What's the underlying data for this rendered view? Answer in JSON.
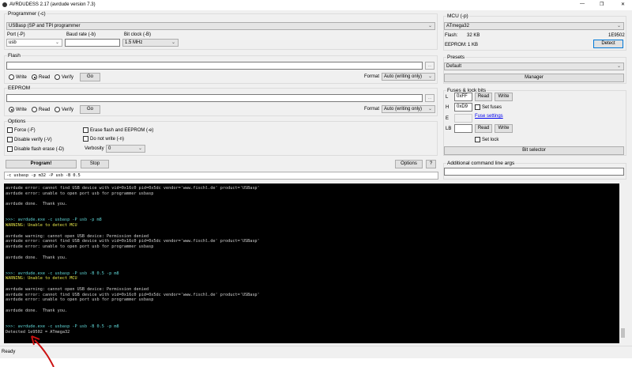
{
  "window": {
    "title": "AVRDUDESS 2.17 (avrdude version 7.3)",
    "minimize": "—",
    "restore": "❐",
    "close": "✕"
  },
  "programmer": {
    "label": "Programmer (-c)",
    "value": "USBasp (SP and TPI programmer",
    "port_label": "Port (-P)",
    "port_value": "usb",
    "baud_label": "Baud rate (-b)",
    "baud_value": "",
    "bitclock_label": "Bit clock (-B)",
    "bitclock_value": "1.5 MHz"
  },
  "flash": {
    "label": "Flash",
    "path": "",
    "browse": "...",
    "write": "Write",
    "read": "Read",
    "verify": "Verify",
    "go": "Go",
    "format_label": "Format",
    "format_value": "Auto (writing only)"
  },
  "eeprom": {
    "label": "EEPROM",
    "path": "",
    "browse": "...",
    "write": "Write",
    "read": "Read",
    "verify": "Verify",
    "go": "Go",
    "format_label": "Format",
    "format_value": "Auto (writing only)"
  },
  "options": {
    "label": "Options",
    "force": "Force (-F)",
    "disable_verify": "Disable verify (-V)",
    "disable_flash_erase": "Disable flash erase (-D)",
    "erase": "Erase flash and EEPROM (-e)",
    "no_write": "Do not write (-n)",
    "verbosity_label": "Verbosity",
    "verbosity_value": "0"
  },
  "actions": {
    "program": "Program!",
    "stop": "Stop",
    "options": "Options",
    "help": "?",
    "command": "-c usbasp -p m32 -P usb -B 0.5"
  },
  "mcu": {
    "label": "MCU (-p)",
    "value": "ATmega32",
    "flash_label": "Flash:",
    "flash_value": "32 KB",
    "signature": "1E9502",
    "eeprom_label": "EEPROM:",
    "eeprom_value": "1 KB",
    "detect": "Detect"
  },
  "presets": {
    "label": "Presets",
    "value": "Default",
    "manager": "Manager"
  },
  "fuses": {
    "label": "Fuses & lock bits",
    "L": "L",
    "L_value": "0xFF",
    "H": "H",
    "H_value": "0xD9",
    "E": "E",
    "E_value": "",
    "LB": "LB",
    "LB_value": "",
    "read": "Read",
    "write": "Write",
    "set_fuses": "Set fuses",
    "fuse_settings": "Fuse settings",
    "set_lock": "Set lock",
    "bit_selector": "Bit selector"
  },
  "additional": {
    "label": "Additional command line args",
    "value": ""
  },
  "console": [
    {
      "t": "n",
      "text": "avrdude error: cannot find USB device with vid=0x16c0 pid=0x5dc vendor='www.fischl.de' product='USBasp'"
    },
    {
      "t": "n",
      "text": "avrdude error: unable to open port usb for programmer usbasp"
    },
    {
      "t": "n",
      "text": ""
    },
    {
      "t": "n",
      "text": "avrdude done.  Thank you."
    },
    {
      "t": "n",
      "text": ""
    },
    {
      "t": "n",
      "text": ""
    },
    {
      "t": "cmd",
      "text": ">>>: avrdude.exe -c usbasp -P usb -p m8"
    },
    {
      "t": "warn",
      "text": "WARNING: Unable to detect MCU"
    },
    {
      "t": "n",
      "text": ""
    },
    {
      "t": "n",
      "text": "avrdude warning: cannot open USB device: Permission denied"
    },
    {
      "t": "n",
      "text": "avrdude error: cannot find USB device with vid=0x16c0 pid=0x5dc vendor='www.fischl.de' product='USBasp'"
    },
    {
      "t": "n",
      "text": "avrdude error: unable to open port usb for programmer usbasp"
    },
    {
      "t": "n",
      "text": ""
    },
    {
      "t": "n",
      "text": "avrdude done.  Thank you."
    },
    {
      "t": "n",
      "text": ""
    },
    {
      "t": "n",
      "text": ""
    },
    {
      "t": "cmd",
      "text": ">>>: avrdude.exe -c usbasp -P usb -B 0.5 -p m8"
    },
    {
      "t": "warn",
      "text": "WARNING: Unable to detect MCU"
    },
    {
      "t": "n",
      "text": ""
    },
    {
      "t": "n",
      "text": "avrdude warning: cannot open USB device: Permission denied"
    },
    {
      "t": "n",
      "text": "avrdude error: cannot find USB device with vid=0x16c0 pid=0x5dc vendor='www.fischl.de' product='USBasp'"
    },
    {
      "t": "n",
      "text": "avrdude error: unable to open port usb for programmer usbasp"
    },
    {
      "t": "n",
      "text": ""
    },
    {
      "t": "n",
      "text": "avrdude done.  Thank you."
    },
    {
      "t": "n",
      "text": ""
    },
    {
      "t": "n",
      "text": ""
    },
    {
      "t": "cmd",
      "text": ">>>: avrdude.exe -c usbasp -P usb -B 0.5 -p m8"
    },
    {
      "t": "n",
      "text": "Detected 1e9502 = ATmega32"
    }
  ],
  "status": "Ready",
  "colors": {
    "console_bg": "#000000",
    "cmd": "#5fd7d7",
    "warning": "#e8e84a",
    "annotation": "#cc1111",
    "link": "#0000ee"
  }
}
